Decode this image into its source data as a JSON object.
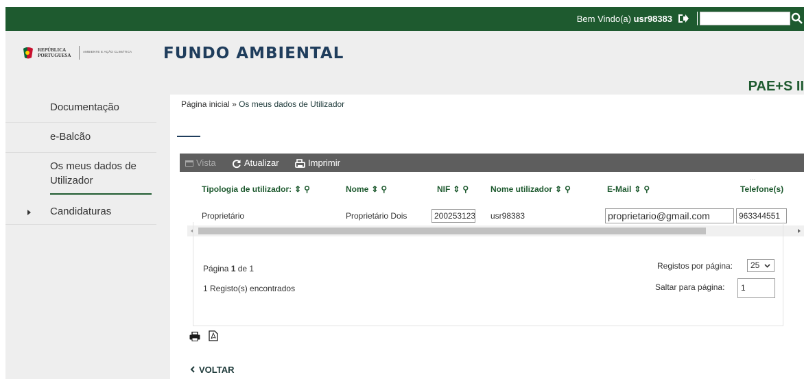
{
  "topbar": {
    "welcome_prefix": "Bem Vindo(a)",
    "username": "usr98383",
    "search_value": ""
  },
  "header": {
    "republica_line1": "REPÚBLICA",
    "republica_line2": "PORTUGUESA",
    "ministry": "AMBIENTE E AÇÃO CLIMÁTICA",
    "brand": "FUNDO AMBIENTAL",
    "program": "PAE+S II"
  },
  "sidebar": {
    "items": [
      {
        "label": "Documentação"
      },
      {
        "label": "e-Balcão"
      },
      {
        "label": "Os meus dados de Utilizador"
      },
      {
        "label": "Candidaturas"
      }
    ]
  },
  "breadcrumb": {
    "home": "Página inicial",
    "sep": "»",
    "current": "Os meus dados de Utilizador"
  },
  "toolbar": {
    "vista": "Vista",
    "atualizar": "Atualizar",
    "imprimir": "Imprimir"
  },
  "table": {
    "columns": [
      "Tipologia de utilizador:",
      "Nome",
      "NIF",
      "Nome utilizador",
      "E-Mail",
      "Telefone(s)"
    ],
    "row": {
      "tipologia": "Proprietário",
      "nome": "Proprietário Dois",
      "nif": "200253123",
      "utilizador": "usr98383",
      "email": "proprietario@gmail.com",
      "telefone": "963344551"
    }
  },
  "pager": {
    "page_prefix": "Página",
    "page_current": "1",
    "page_of": "de 1",
    "found": "1 Registo(s) encontrados",
    "per_page_label": "Registos por página:",
    "per_page_value": "25",
    "jump_label": "Saltar para página:",
    "jump_value": "1"
  },
  "footer": {
    "voltar": "VOLTAR"
  },
  "colors": {
    "brand_green": "#1e5a2f",
    "toolbar_gray": "#5e5e5e",
    "navy": "#1f3d5c"
  }
}
